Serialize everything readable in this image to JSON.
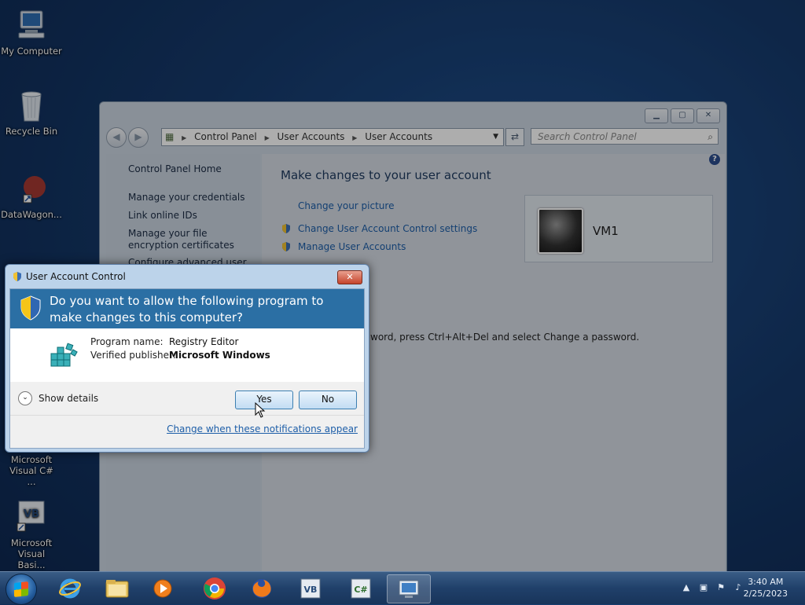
{
  "desktop": {
    "icons": [
      {
        "label": "My Computer"
      },
      {
        "label": "Recycle Bin"
      },
      {
        "label": "DataWagon..."
      },
      {
        "label": "Microsoft Visual C# ..."
      },
      {
        "label": "Microsoft Visual Basi..."
      }
    ]
  },
  "explorer": {
    "address": {
      "c1": "Control Panel",
      "c2": "User Accounts",
      "c3": "User Accounts"
    },
    "search_placeholder": "Search Control Panel",
    "sidebar": {
      "home": "Control Panel Home",
      "credentials": "Manage your credentials",
      "online_ids": "Link online IDs",
      "encryption": "Manage your file encryption certificates",
      "configure": "Configure advanced user profile properties"
    },
    "main": {
      "heading": "Make changes to your user account",
      "change_picture": "Change your picture",
      "uac_settings": "Change User Account Control settings",
      "manage_accounts": "Manage User Accounts",
      "password_hint": "word, press Ctrl+Alt+Del and select Change a password."
    },
    "account": {
      "name": "VM1"
    }
  },
  "uac_dialog": {
    "title": "User Account Control",
    "question": "Do you want to allow the following program to make changes to this computer?",
    "program_name_label": "Program name:",
    "program_name": "Registry Editor",
    "publisher_label": "Verified publisher:",
    "publisher": "Microsoft Windows",
    "show_details": "Show details",
    "yes": "Yes",
    "no": "No",
    "change_link": "Change when these notifications appear"
  },
  "taskbar": {
    "clock_time": "3:40 AM",
    "clock_date": "2/25/2023",
    "apps": [
      "internet-explorer",
      "file-explorer",
      "media-player",
      "chrome",
      "firefox",
      "visual-basic",
      "visual-csharp",
      "control-panel"
    ]
  }
}
